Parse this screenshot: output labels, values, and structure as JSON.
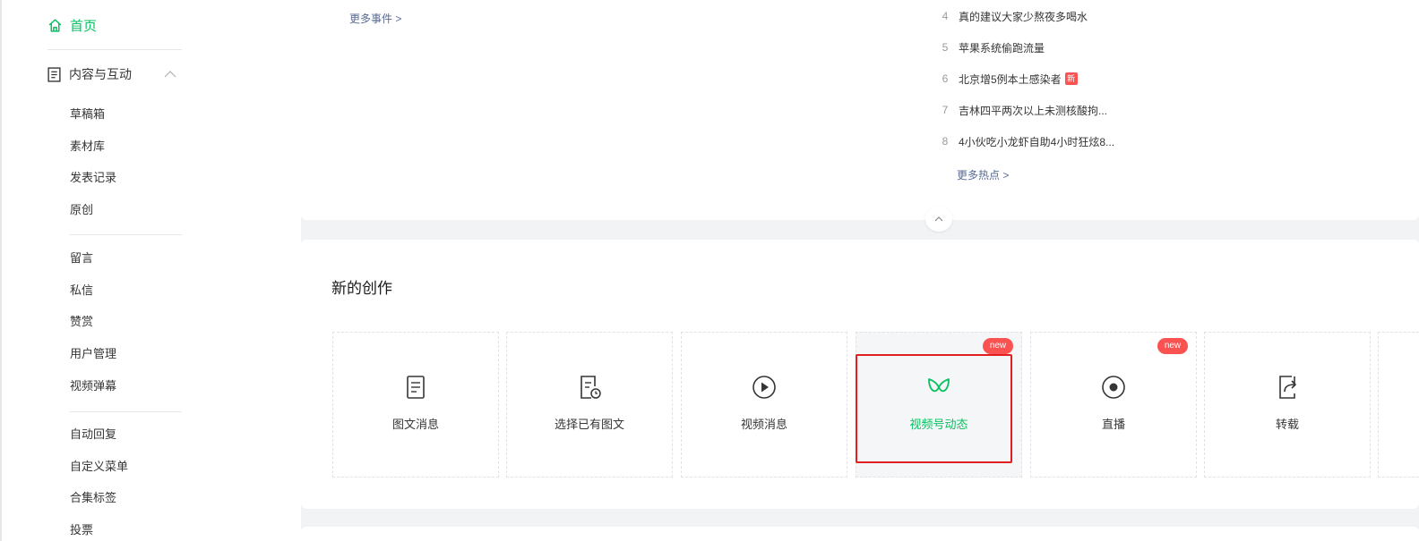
{
  "sidebar": {
    "home_label": "首页",
    "group_label": "内容与互动",
    "items": [
      "草稿箱",
      "素材库",
      "发表记录",
      "原创",
      "留言",
      "私信",
      "赞赏",
      "用户管理",
      "视频弹幕",
      "自动回复",
      "自定义菜单",
      "合集标签",
      "投票"
    ]
  },
  "events": {
    "more_label": "更多事件 >"
  },
  "hot": {
    "list": [
      {
        "rank": "4",
        "title": "真的建议大家少熬夜多喝水"
      },
      {
        "rank": "5",
        "title": "苹果系统偷跑流量"
      },
      {
        "rank": "6",
        "title": "北京增5例本土感染者",
        "badge": "新"
      },
      {
        "rank": "7",
        "title": "吉林四平两次以上未测核酸拘..."
      },
      {
        "rank": "8",
        "title": "4小伙吃小龙虾自助4小时狂炫8..."
      }
    ],
    "more_label": "更多热点 >"
  },
  "create": {
    "title": "新的创作",
    "tiles": [
      {
        "label": "图文消息",
        "icon": "article-icon"
      },
      {
        "label": "选择已有图文",
        "icon": "article-history-icon"
      },
      {
        "label": "视频消息",
        "icon": "play-icon"
      },
      {
        "label": "视频号动态",
        "icon": "channels-icon",
        "badge": "new",
        "active": true
      },
      {
        "label": "直播",
        "icon": "live-icon",
        "badge": "new"
      },
      {
        "label": "转载",
        "icon": "repost-icon"
      }
    ]
  },
  "colors": {
    "accent": "#07c160",
    "link": "#576b95",
    "badge": "#fa5151",
    "highlight": "#e02020"
  }
}
